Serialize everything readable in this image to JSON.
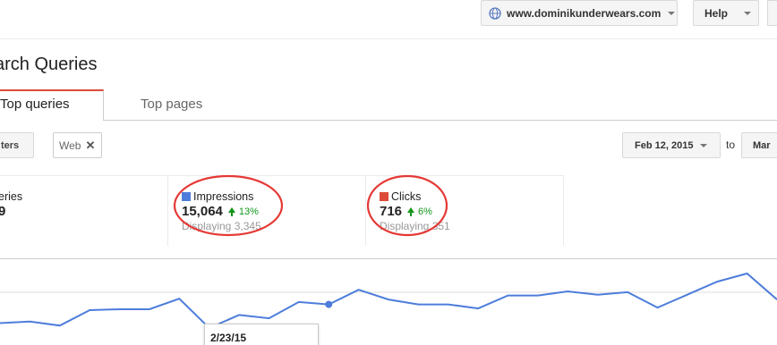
{
  "topbar": {
    "site": "www.dominikunderwears.com",
    "help_label": "Help"
  },
  "page": {
    "title": "arch Queries"
  },
  "tabs": [
    {
      "label": "Top queries",
      "active": true
    },
    {
      "label": "Top pages",
      "active": false
    }
  ],
  "filters": {
    "filter_button": "ters",
    "chip_label": "Web",
    "chip_remove": "✕"
  },
  "date_range": {
    "start": "Feb 12, 2015",
    "to_label": "to",
    "end": "Mar"
  },
  "metrics": [
    {
      "label": "eries",
      "value": "9",
      "change": "",
      "displaying": ""
    },
    {
      "label": "Impressions",
      "value": "15,064",
      "change": "13%",
      "displaying": "Displaying 3,345",
      "color": "#4d7ddb",
      "circled": true
    },
    {
      "label": "Clicks",
      "value": "716",
      "change": "6%",
      "displaying": "Displaying 351",
      "color": "#dd4b39",
      "circled": true
    }
  ],
  "colors": {
    "accent": "#dd4b39",
    "line": "#4d7ddb",
    "up": "#109618",
    "annotation": "#e53935"
  },
  "chart_data": {
    "type": "line",
    "series": [
      {
        "values": [
          28,
          30,
          25,
          44,
          45,
          45,
          58,
          22,
          38,
          34,
          54,
          51,
          69,
          57,
          51,
          51,
          46,
          62,
          62,
          67,
          63,
          66,
          47,
          63,
          79,
          89,
          57
        ]
      }
    ],
    "highlighted_index": 11,
    "tooltip_label": "2/23/15",
    "ylim": [
      0,
      100
    ]
  }
}
